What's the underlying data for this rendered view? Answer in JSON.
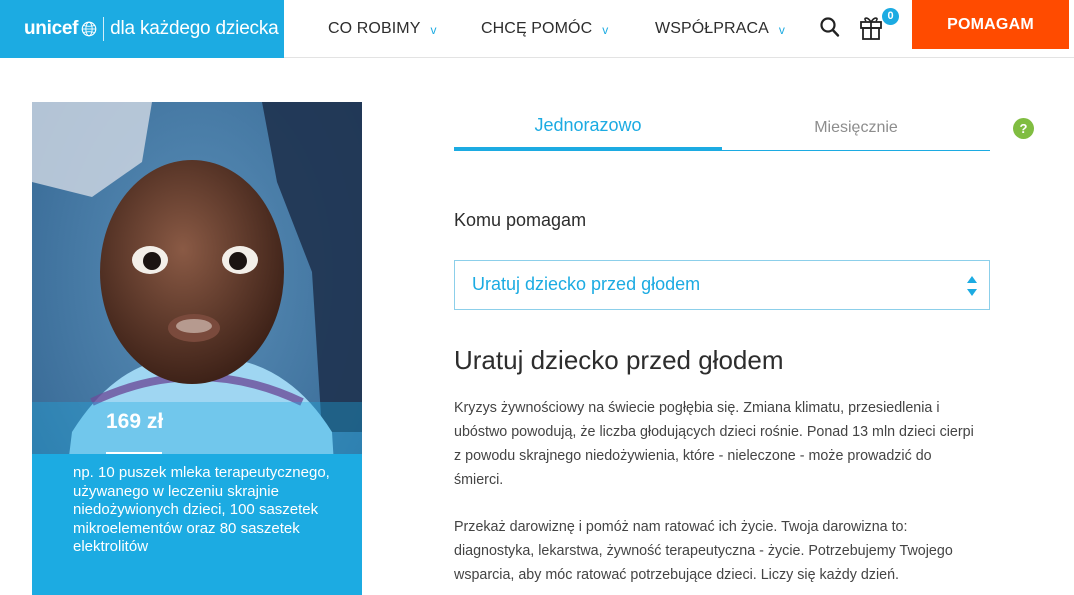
{
  "header": {
    "brand": {
      "logo_text": "unicef",
      "tagline": "dla każdego dziecka"
    },
    "nav": [
      {
        "label": "CO ROBIMY",
        "chevron": "v"
      },
      {
        "label": "CHCĘ POMÓC",
        "chevron": "v"
      },
      {
        "label": "WSPÓŁPRACA",
        "chevron": "v"
      }
    ],
    "search_icon": "search-icon",
    "gift_icon": "gift-icon",
    "cart_count": "0",
    "cta_label": "POMAGAM"
  },
  "card": {
    "amount": "169 zł",
    "description": "np. 10 puszek mleka terapeutycznego, używanego w leczeniu skrajnie niedożywionych dzieci, 100 saszetek mikroelementów oraz 80 saszetek elektrolitów"
  },
  "form": {
    "tabs": [
      {
        "label": "Jednorazowo",
        "active": true
      },
      {
        "label": "Miesięcznie",
        "active": false
      }
    ],
    "help_label": "?",
    "select_label": "Komu pomagam",
    "select_value": "Uratuj dziecko przed głodem"
  },
  "content": {
    "title": "Uratuj dziecko przed głodem",
    "paragraphs": [
      "Kryzys żywnościowy na świecie pogłębia się. Zmiana klimatu, przesiedlenia i ubóstwo powodują, że liczba głodujących dzieci rośnie. Ponad 13 mln dzieci cierpi z powodu skrajnego niedożywienia, które - nieleczone - może prowadzić do śmierci.",
      "Przekaż darowiznę i pomóż nam ratować ich życie. Twoja darowizna to: diagnostyka, lekarstwa, żywność terapeutyczna - życie. Potrzebujemy Twojego wsparcia, aby móc ratować potrzebujące dzieci. Liczy się każdy dzień."
    ]
  },
  "colors": {
    "brand_blue": "#1cabe2",
    "cta_orange": "#ff4b00",
    "help_green": "#80bd41",
    "text_dark": "#2d2d2d"
  }
}
